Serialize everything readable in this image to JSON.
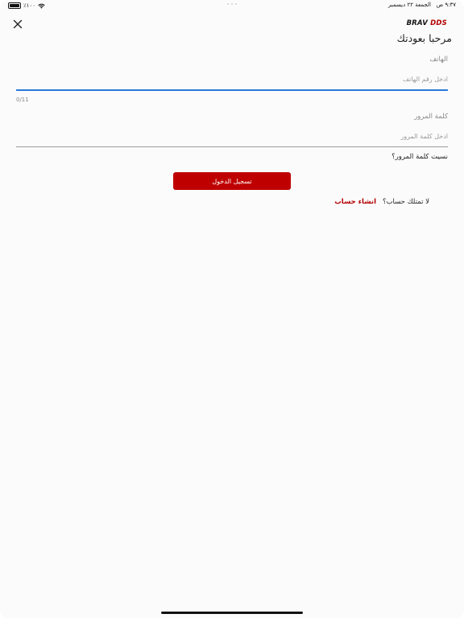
{
  "status_bar": {
    "time": "٩:٣٧ ص",
    "date": "الجمعة ٢٢ ديسمبر",
    "battery_text": "٪١٠٠",
    "battery_level": 1.0
  },
  "header": {
    "logo_main": "BRAV",
    "logo_accent": "DDS",
    "accent_color": "#b30000",
    "close_icon": "close-icon"
  },
  "welcome_title": "مرحبا بعودتك",
  "phone": {
    "label": "الهاتف",
    "placeholder": "ادخل رقم الهاتف",
    "value": "",
    "counter": "0/11"
  },
  "password": {
    "label": "كلمة المرور",
    "placeholder": "ادخل كلمة المرور",
    "value": ""
  },
  "forgot_password": "نسيت كلمة المرور؟",
  "login_button": "تسجيل الدخول",
  "signup": {
    "prompt": "لا تمتلك حساب؟",
    "link": "انشاء حساب"
  },
  "colors": {
    "primary": "#bf0000",
    "focus": "#2a7ad8"
  }
}
